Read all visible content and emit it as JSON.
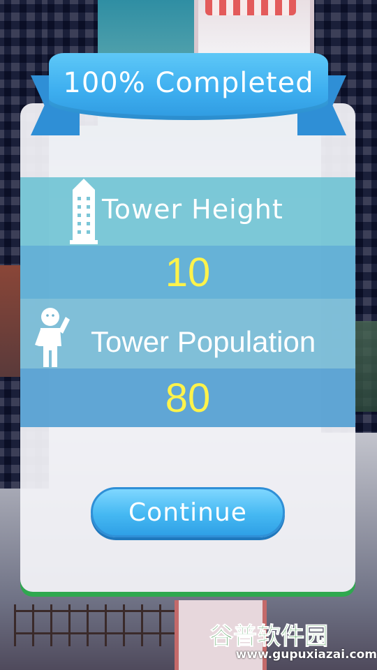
{
  "banner": {
    "title": "100% Completed"
  },
  "stats": {
    "height_label": "Tower Height",
    "height_value": "10",
    "population_label": "Tower Population",
    "population_value": "80"
  },
  "actions": {
    "continue_label": "Continue"
  },
  "watermark": {
    "site_name": "谷普软件园",
    "url": "www.gupuxiazai.com"
  },
  "icons": {
    "height_icon": "building-icon",
    "population_icon": "person-waving-icon"
  },
  "colors": {
    "value_text": "#fff34a",
    "ribbon": "#3eaff0",
    "button": "#45b8f2",
    "card_accent": "#2fa84f"
  }
}
